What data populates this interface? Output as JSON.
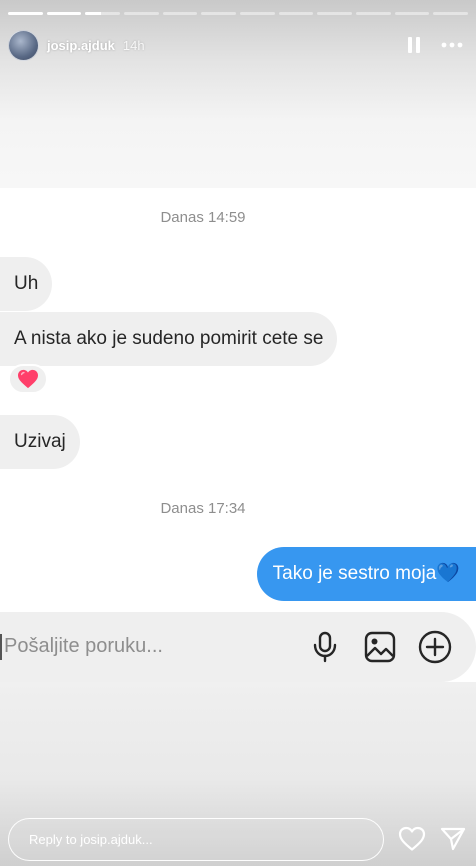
{
  "story": {
    "username": "josip.ajduk",
    "time_ago": "14h",
    "progress": {
      "segments": 12,
      "completed": 2,
      "current_fraction": 0.45
    }
  },
  "chat": {
    "timestamp_1": "Danas 14:59",
    "messages_in": [
      {
        "text": "Uh"
      },
      {
        "text": "A nista ako je sudeno pomirit cete se"
      },
      {
        "text": "Uzivaj"
      }
    ],
    "reaction": "heart",
    "timestamp_2": "Danas 17:34",
    "message_out": "Tako je sestro moja💙",
    "compose_placeholder": "Pošaljite poruku..."
  },
  "reply": {
    "placeholder": "Reply to josip.ajduk..."
  },
  "colors": {
    "outgoing_bubble": "#3797f0",
    "incoming_bubble": "#efefef",
    "timestamp_text": "#8e8e8e"
  }
}
